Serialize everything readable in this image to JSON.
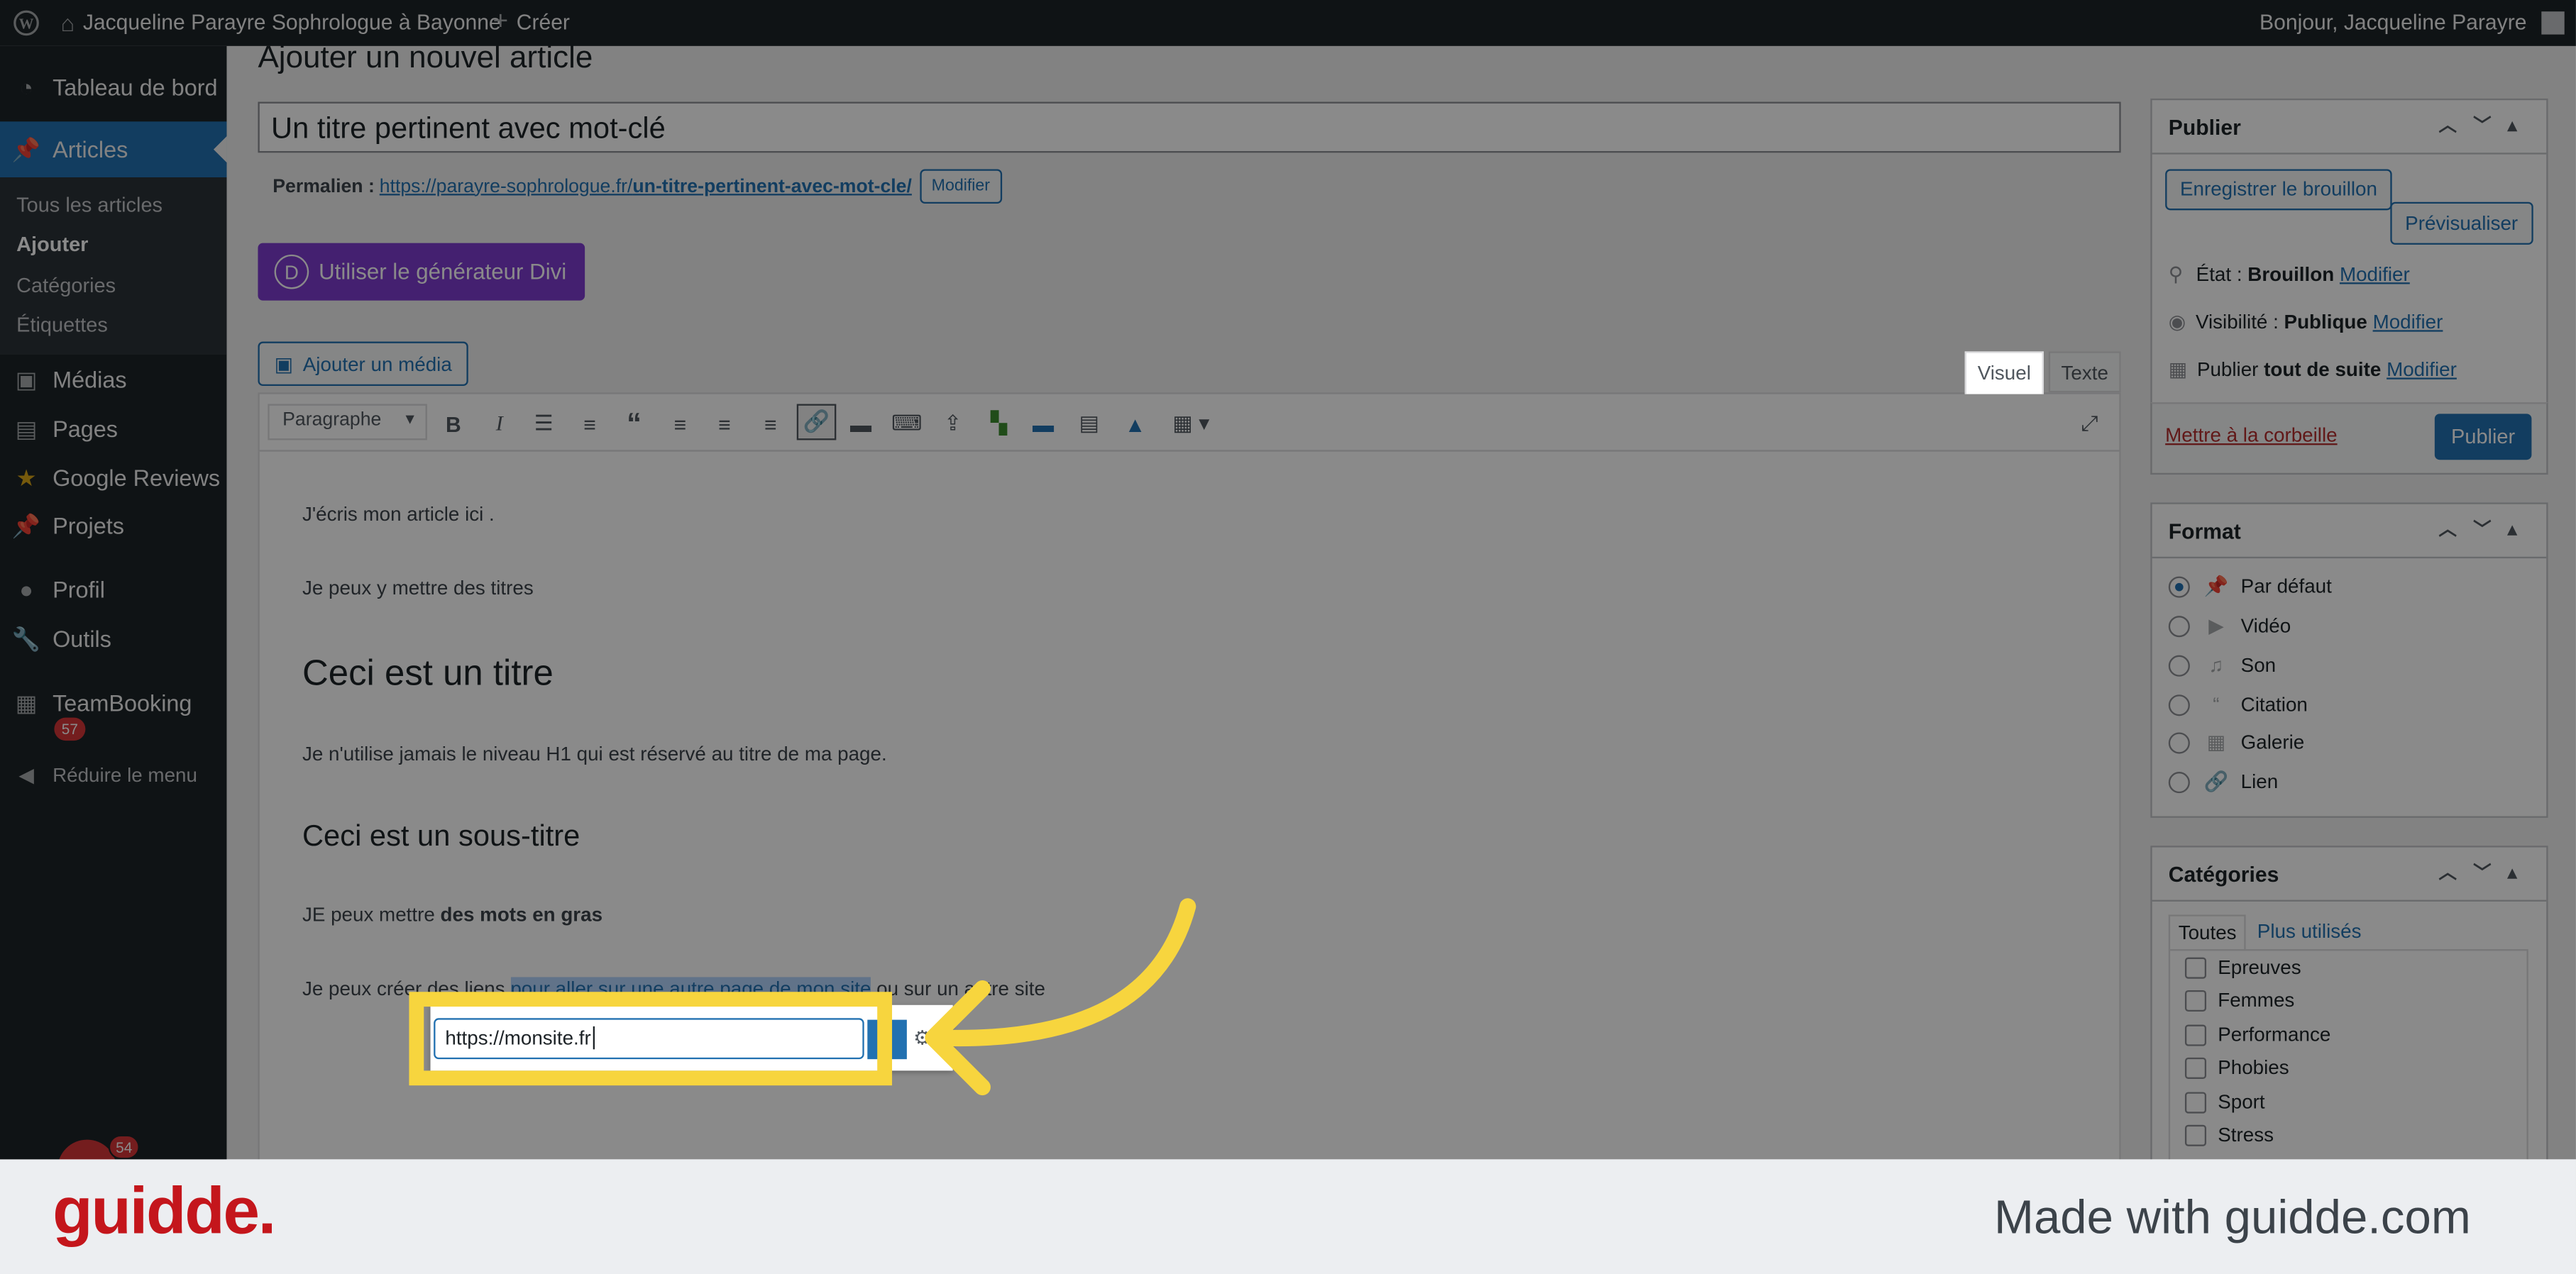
{
  "adminbar": {
    "site_name": "Jacqueline Parayre Sophrologue à Bayonne",
    "new_label": "Créer",
    "greeting": "Bonjour, Jacqueline Parayre"
  },
  "sidebar": {
    "dashboard": "Tableau de bord",
    "articles": "Articles",
    "sub": {
      "all": "Tous les articles",
      "add": "Ajouter",
      "cats": "Catégories",
      "tags": "Étiquettes"
    },
    "media": "Médias",
    "pages": "Pages",
    "reviews": "Google Reviews",
    "projects": "Projets",
    "profile": "Profil",
    "tools": "Outils",
    "teambooking": "TeamBooking",
    "teambooking_badge": "57",
    "collapse": "Réduire le menu",
    "avatar_badge": "54"
  },
  "editor": {
    "page_title": "Ajouter un nouvel article",
    "post_title": "Un titre pertinent avec mot-clé",
    "permalink_label": "Permalien :",
    "permalink_base": "https://parayre-sophrologue.fr/",
    "permalink_slug": "un-titre-pertinent-avec-mot-cle/",
    "permalink_edit": "Modifier",
    "divi_button": "Utiliser le générateur Divi",
    "divi_letter": "D",
    "add_media": "Ajouter un média",
    "tab_visual": "Visuel",
    "tab_text": "Texte",
    "format_select": "Paragraphe",
    "content": {
      "p1": "J'écris mon article ici .",
      "p2": "Je peux y mettre des titres",
      "h1": "Ceci est un titre",
      "p3": "Je n'utilise jamais le niveau H1 qui est réservé au titre de ma page.",
      "h2": "Ceci est un sous-titre",
      "p4_start": "JE peux mettre ",
      "p4_bold": "des mots en gras",
      "p5_start": "Je peux créer des liens ",
      "p5_link": "pour aller sur une autre page de mon site",
      "p5_end": " ou sur un autre site"
    },
    "link_input_value": "https://monsite.fr"
  },
  "publish": {
    "title": "Publier",
    "save_draft": "Enregistrer le brouillon",
    "preview": "Prévisualiser",
    "state_label": "État :",
    "state_value": "Brouillon",
    "visibility_label": "Visibilité :",
    "visibility_value": "Publique",
    "publish_label": "Publier",
    "publish_value": "tout de suite",
    "edit": "Modifier",
    "trash": "Mettre à la corbeille",
    "publish_button": "Publier"
  },
  "format": {
    "title": "Format",
    "options": [
      "Par défaut",
      "Vidéo",
      "Son",
      "Citation",
      "Galerie",
      "Lien"
    ]
  },
  "categories": {
    "title": "Catégories",
    "tab_all": "Toutes",
    "tab_popular": "Plus utilisés",
    "items": [
      "Epreuves",
      "Femmes",
      "Performance",
      "Phobies",
      "Sport",
      "Stress"
    ]
  },
  "footer": {
    "brand": "guidde.",
    "made_with": "Made with guidde.com"
  },
  "colors": {
    "accent": "#2271b1",
    "divi": "#7e3bd0",
    "highlight": "#f7d53e",
    "brand_red": "#c4161c"
  }
}
